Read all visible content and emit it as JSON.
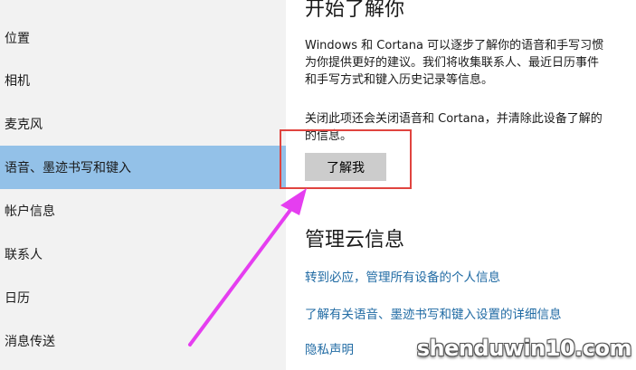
{
  "sidebar": {
    "items": [
      {
        "label": "位置"
      },
      {
        "label": "相机"
      },
      {
        "label": "麦克风"
      },
      {
        "label": "语音、墨迹书写和键入",
        "selected": true
      },
      {
        "label": "帐户信息"
      },
      {
        "label": "联系人"
      },
      {
        "label": "日历"
      },
      {
        "label": "消息传送"
      }
    ]
  },
  "section1": {
    "title": "开始了解你",
    "para_line1": "Windows 和 Cortana 可以逐步了解你的语音和手写习惯",
    "para_line2": "为你提供更好的建议。我们将收集联系人、最近日历事件",
    "para_line3": "和手写方式和键入历史记录等信息。",
    "note_line1": "关闭此项还会关闭语音和 Cortana，并清除此设备了解的",
    "note_line2": "的信息。",
    "button": "了解我"
  },
  "section2": {
    "title": "管理云信息",
    "link1": "转到必应，管理所有设备的个人信息",
    "link2": "了解有关语音、墨迹书写和键入设置的详细信息",
    "link3": "隐私声明"
  },
  "watermark": "shenduwin10.com",
  "colors": {
    "selected_bg": "#93c1e8",
    "sidebar_bg": "#f2f2f2",
    "link": "#1f6aa3",
    "annotation_box": "#e0443f",
    "annotation_arrow": "#e53ef0"
  }
}
